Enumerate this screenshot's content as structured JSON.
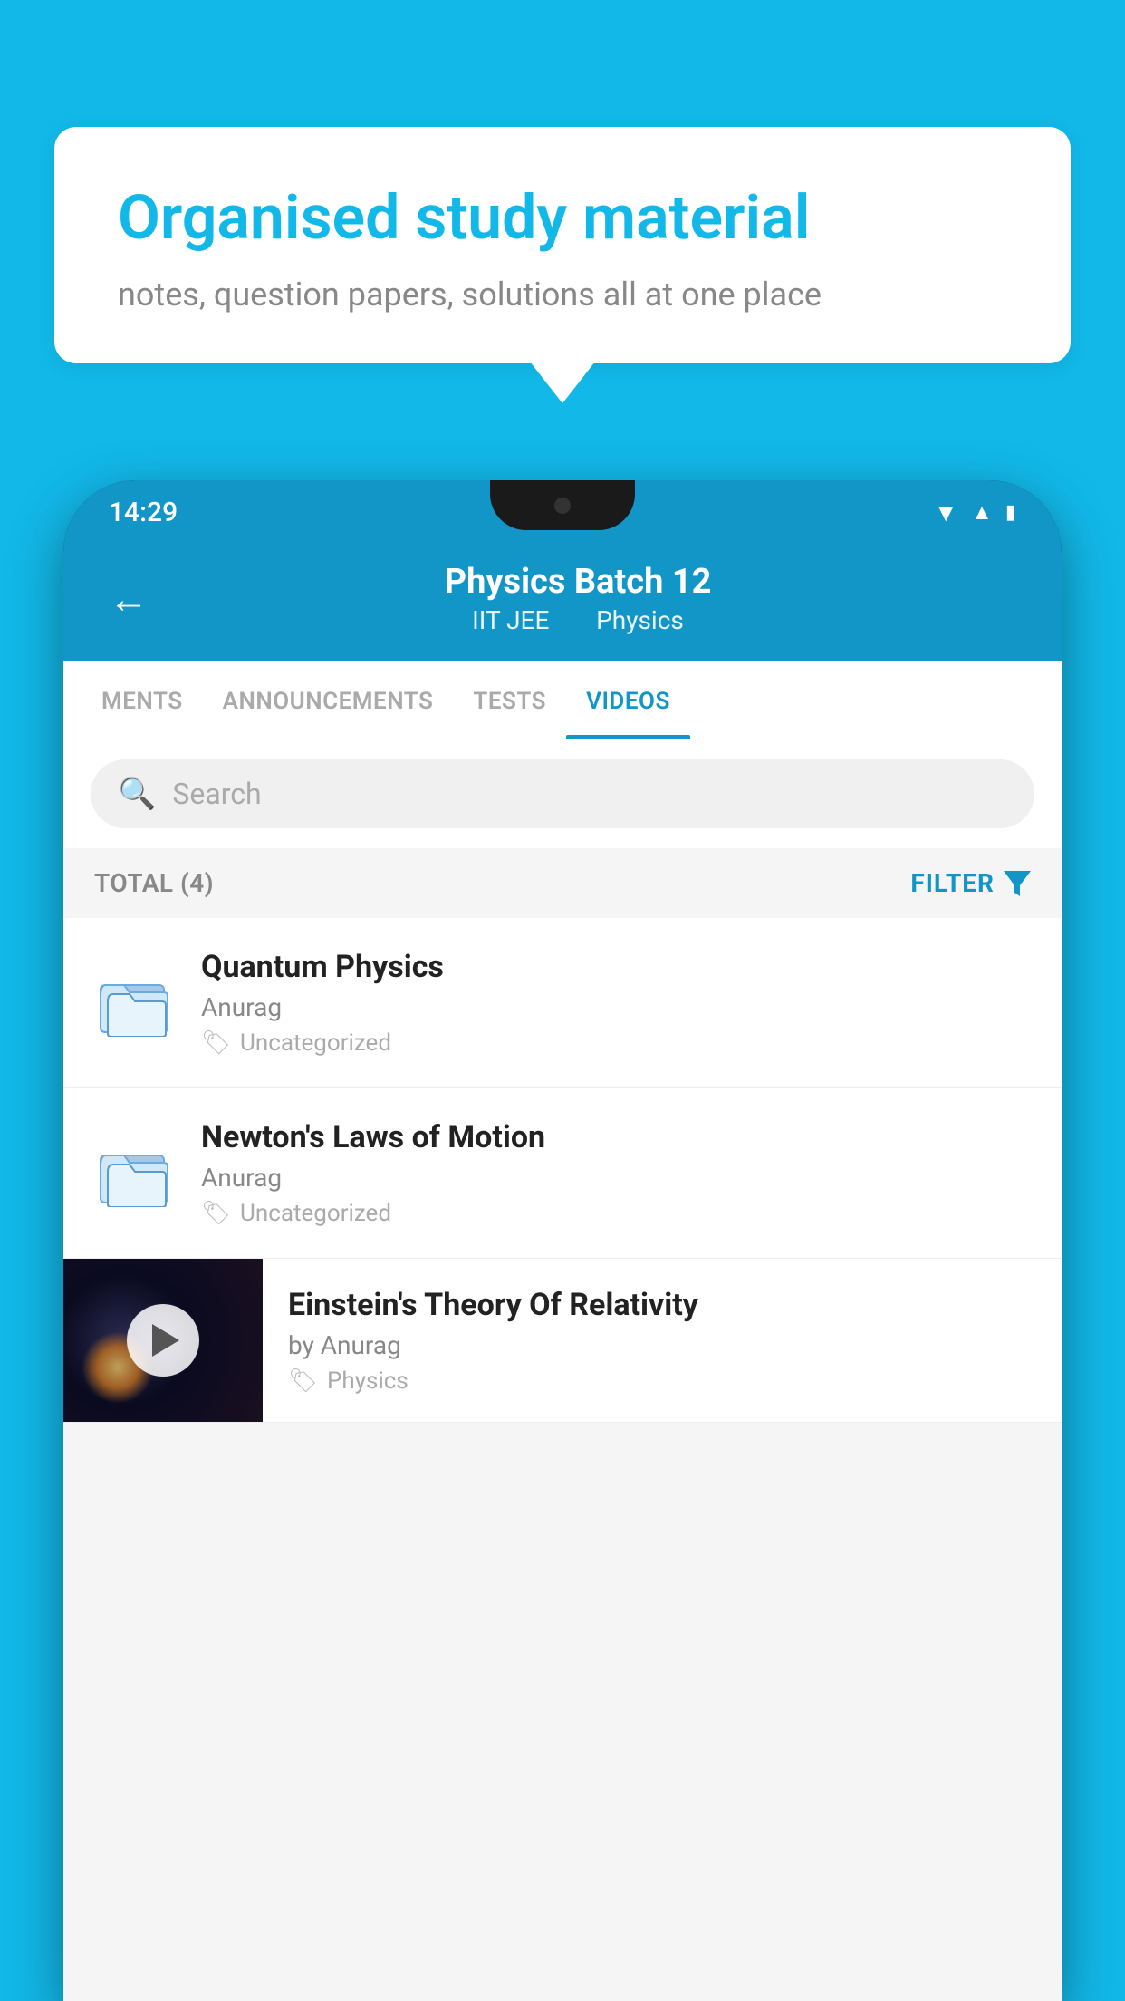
{
  "background": {
    "color": "#12B8E8"
  },
  "speech_bubble": {
    "title": "Organised study material",
    "subtitle": "notes, question papers, solutions all at one place"
  },
  "status_bar": {
    "time": "14:29",
    "icons": [
      "wifi",
      "signal",
      "battery"
    ]
  },
  "app_header": {
    "back_label": "←",
    "title": "Physics Batch 12",
    "subtitle_left": "IIT JEE",
    "subtitle_right": "Physics"
  },
  "tabs": [
    {
      "label": "MENTS",
      "active": false
    },
    {
      "label": "ANNOUNCEMENTS",
      "active": false
    },
    {
      "label": "TESTS",
      "active": false
    },
    {
      "label": "VIDEOS",
      "active": true
    }
  ],
  "search": {
    "placeholder": "Search"
  },
  "filter_bar": {
    "total_label": "TOTAL (4)",
    "filter_label": "FILTER"
  },
  "video_list": [
    {
      "title": "Quantum Physics",
      "author": "Anurag",
      "tag": "Uncategorized",
      "type": "folder"
    },
    {
      "title": "Newton's Laws of Motion",
      "author": "Anurag",
      "tag": "Uncategorized",
      "type": "folder"
    },
    {
      "title": "Einstein's Theory Of Relativity",
      "author": "by Anurag",
      "tag": "Physics",
      "type": "video"
    }
  ]
}
